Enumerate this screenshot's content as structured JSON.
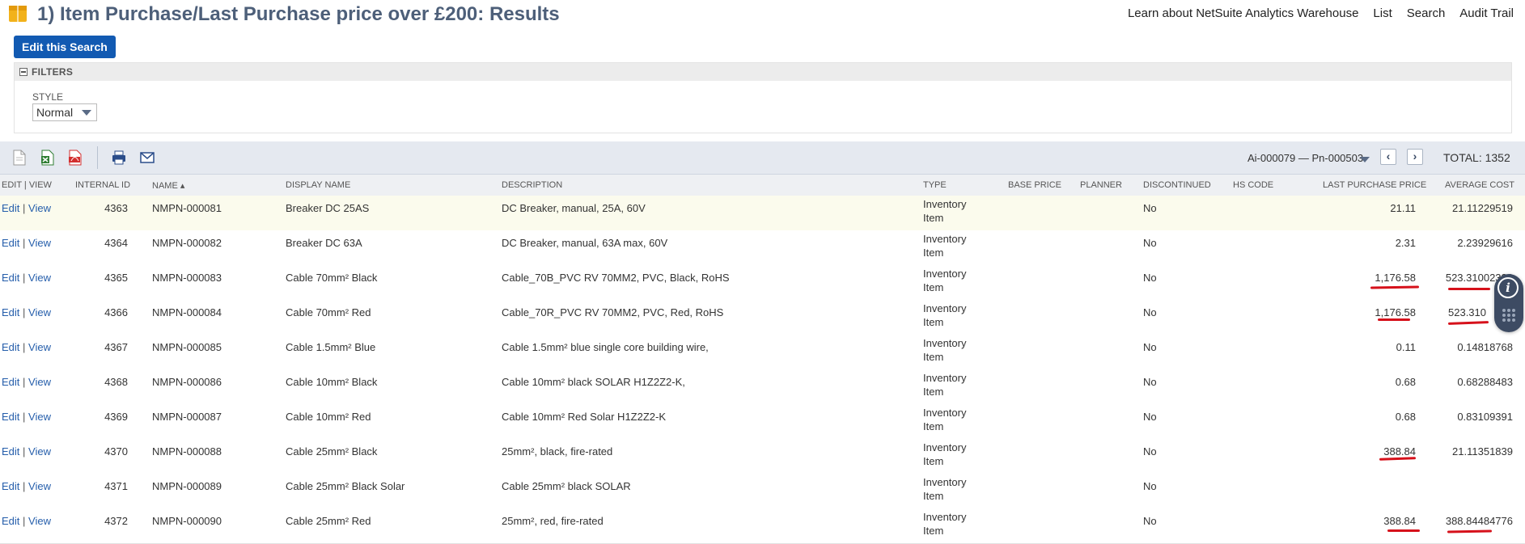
{
  "header": {
    "title": "1) Item Purchase/Last Purchase price over £200: Results",
    "links": [
      "Learn about NetSuite Analytics Warehouse",
      "List",
      "Search",
      "Audit Trail"
    ]
  },
  "edit_search_label": "Edit this Search",
  "filters": {
    "heading": "FILTERS",
    "style_label": "STYLE",
    "style_value": "Normal"
  },
  "toolbar": {
    "pager_range": "Ai-000079 — Pn-000503",
    "total": "TOTAL: 1352"
  },
  "table": {
    "columns": [
      "EDIT | VIEW",
      "INTERNAL ID",
      "NAME ▴",
      "DISPLAY NAME",
      "DESCRIPTION",
      "TYPE",
      "BASE PRICE",
      "PLANNER",
      "DISCONTINUED",
      "HS CODE",
      "LAST PURCHASE PRICE",
      "AVERAGE COST"
    ],
    "rows": [
      {
        "edit": "Edit",
        "view": "View",
        "id": "4363",
        "name": "NMPN-000081",
        "display": "Breaker DC 25AS",
        "desc": "DC Breaker, manual, 25A, 60V",
        "type1": "Inventory",
        "type2": "Item",
        "disc": "No",
        "lpp": "21.11",
        "avg": "21.11229519"
      },
      {
        "edit": "Edit",
        "view": "View",
        "id": "4364",
        "name": "NMPN-000082",
        "display": "Breaker DC 63A",
        "desc": "DC Breaker, manual, 63A max, 60V",
        "type1": "Inventory",
        "type2": "Item",
        "disc": "No",
        "lpp": "2.31",
        "avg": "2.23929616"
      },
      {
        "edit": "Edit",
        "view": "View",
        "id": "4365",
        "name": "NMPN-000083",
        "display": "Cable 70mm² Black",
        "desc": "Cable_70B_PVC RV 70MM2, PVC, Black, RoHS",
        "type1": "Inventory",
        "type2": "Item",
        "disc": "No",
        "lpp": "1,176.58",
        "avg": "523.31002322"
      },
      {
        "edit": "Edit",
        "view": "View",
        "id": "4366",
        "name": "NMPN-000084",
        "display": "Cable 70mm² Red",
        "desc": "Cable_70R_PVC RV 70MM2, PVC, Red, RoHS",
        "type1": "Inventory",
        "type2": "Item",
        "disc": "No",
        "lpp": "1,176.58",
        "avg": "523.310"
      },
      {
        "edit": "Edit",
        "view": "View",
        "id": "4367",
        "name": "NMPN-000085",
        "display": "Cable 1.5mm² Blue",
        "desc": "Cable 1.5mm² blue single core building wire,",
        "type1": "Inventory",
        "type2": "Item",
        "disc": "No",
        "lpp": "0.11",
        "avg": "0.14818768"
      },
      {
        "edit": "Edit",
        "view": "View",
        "id": "4368",
        "name": "NMPN-000086",
        "display": "Cable 10mm² Black",
        "desc": "Cable 10mm² black SOLAR H1Z2Z2-K,",
        "type1": "Inventory",
        "type2": "Item",
        "disc": "No",
        "lpp": "0.68",
        "avg": "0.68288483"
      },
      {
        "edit": "Edit",
        "view": "View",
        "id": "4369",
        "name": "NMPN-000087",
        "display": "Cable 10mm² Red",
        "desc": "Cable 10mm² Red Solar H1Z2Z2-K",
        "type1": "Inventory",
        "type2": "Item",
        "disc": "No",
        "lpp": "0.68",
        "avg": "0.83109391"
      },
      {
        "edit": "Edit",
        "view": "View",
        "id": "4370",
        "name": "NMPN-000088",
        "display": "Cable 25mm² Black",
        "desc": "25mm², black, fire-rated",
        "type1": "Inventory",
        "type2": "Item",
        "disc": "No",
        "lpp": "388.84",
        "avg": "21.11351839"
      },
      {
        "edit": "Edit",
        "view": "View",
        "id": "4371",
        "name": "NMPN-000089",
        "display": "Cable 25mm² Black Solar",
        "desc": "Cable 25mm² black SOLAR",
        "type1": "Inventory",
        "type2": "Item",
        "disc": "No",
        "lpp": "",
        "avg": ""
      },
      {
        "edit": "Edit",
        "view": "View",
        "id": "4372",
        "name": "NMPN-000090",
        "display": "Cable 25mm² Red",
        "desc": "25mm², red, fire-rated",
        "type1": "Inventory",
        "type2": "Item",
        "disc": "No",
        "lpp": "388.84",
        "avg": "388.84484776"
      }
    ]
  },
  "colors": {
    "title": "#4d5f79",
    "primary_button": "#125ab2",
    "link": "#255eab",
    "annotation_red": "#d6111b"
  }
}
